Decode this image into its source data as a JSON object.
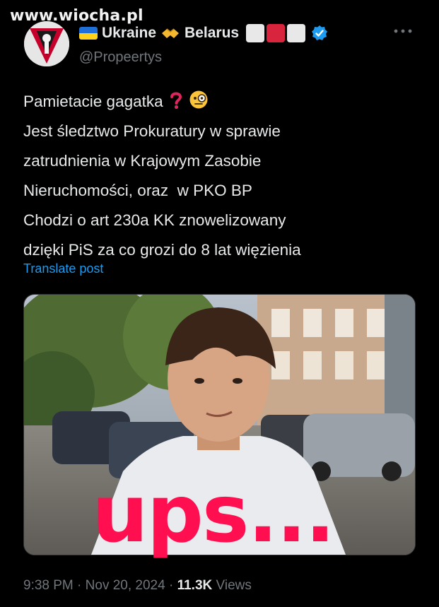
{
  "watermark": "www.wiocha.pl",
  "author": {
    "display_name_part1": "Ukraine",
    "display_name_part2": "Belarus",
    "handle": "@Propeertys",
    "icons": [
      "ukraine-flag-emoji",
      "handshake-emoji",
      "white-red-white-flag",
      "verified-badge"
    ]
  },
  "post": {
    "lines": [
      "Pamietacie gagatka",
      "Jest śledztwo Prokuratury w sprawie",
      "zatrudnienia w Krajowym Zasobie",
      "Nieruchomości, oraz  w PKO BP",
      "Chodzi o art 230a KK znowelizowany",
      "dzięki PiS za co grozi do 8 lat więzienia"
    ],
    "emojis": [
      "red-question-mark",
      "face-with-monocle"
    ],
    "translate_label": "Translate post"
  },
  "media": {
    "caption": "ups..."
  },
  "meta": {
    "time": "9:38 PM",
    "separator1": "·",
    "date": "Nov 20, 2024",
    "separator2": "·",
    "views_count": "11.3K",
    "views_label": "Views"
  },
  "colors": {
    "background": "#000000",
    "text": "#e7e9ea",
    "secondary": "#71767b",
    "link": "#1d9bf0",
    "caption": "#ff0f4f"
  }
}
